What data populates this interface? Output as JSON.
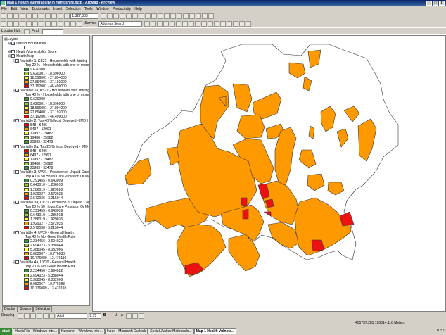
{
  "window": {
    "title": "Map 1 Health Vulnerability in Hampshire.mxd - ArcMap - ArcView",
    "minimize": "_",
    "maximize": "□",
    "close": "x"
  },
  "menu": [
    "File",
    "Edit",
    "View",
    "Bookmarks",
    "Insert",
    "Selection",
    "Tools",
    "Window",
    "Productivity",
    "Help"
  ],
  "toolbar": {
    "scale_value": "1:327,803",
    "service_label": "Service",
    "address_label": "Address Search",
    "locator_label": "Locator Hub",
    "find_label": "Find:"
  },
  "toc": {
    "root": "Layers",
    "layers": [
      {
        "label": "District Boundaries",
        "checked": true
      },
      {
        "label": "Health Vulnerability Score",
        "checked": false
      },
      {
        "label": "Health Map",
        "checked": true
      }
    ],
    "variables": [
      {
        "title": "Variable 1, KS21 - Households with limiting lon",
        "checked": true,
        "subtitle": "Top 20 % - Households with one or more",
        "classes": [
          "9.620000",
          "9.620001 - 18.596000",
          "18.596001 - 27.894000",
          "27.894001 - 37.192000",
          "37.192001 - 46.490000"
        ],
        "colors": [
          "#339933",
          "#99cc33",
          "#ffff33",
          "#ff9900",
          "#ee0000"
        ]
      },
      {
        "title": "Variable 1a, KS21 - Households with limiting lo",
        "checked": true,
        "subtitle": "Top 40 % - Households with one or more",
        "classes": [
          "9.620000",
          "9.620001 - 18.596000",
          "18.596001 - 27.894000",
          "27.894001 - 37.192000",
          "37.192001 - 46.490000"
        ],
        "colors": [
          "#339933",
          "#99cc33",
          "#ffff33",
          "#ff9900",
          "#ee0000"
        ]
      },
      {
        "title": "Variable 2, Top 40 % Most Deprived - IMD He",
        "checked": false,
        "subtitle": "",
        "classes": [
          "848 - 6496",
          "6497 - 12991",
          "12992 - 19487",
          "19488 - 25982",
          "25983 - 32478"
        ],
        "colors": [
          "#ee0000",
          "#ff9900",
          "#ffff33",
          "#99cc33",
          "#339933"
        ]
      },
      {
        "title": "Variable 2a, Top 20 % Most Deprived - IMD H",
        "checked": false,
        "subtitle": "",
        "classes": [
          "848 - 6496",
          "6497 - 12991",
          "12992 - 19487",
          "19488 - 25982",
          "25983 - 32478"
        ],
        "colors": [
          "#ee0000",
          "#ff9900",
          "#ffff33",
          "#99cc33",
          "#339933"
        ]
      },
      {
        "title": "Variable 3, UV21 - Provision of Unpaid Care",
        "checked": false,
        "subtitle": "Top 40 % 50 Hours Care Provision Or Mor",
        "classes": [
          "0.291455 - 0.643009",
          "0.643010 - 1.286018",
          "1.286019 - 1.929026",
          "1.929027 - 2.572035",
          "2.572036 - 3.215044"
        ],
        "colors": [
          "#339933",
          "#99cc33",
          "#ffff33",
          "#ff9900",
          "#ee0000"
        ]
      },
      {
        "title": "Variable 3a, UV21 - Provision of Unpaid Care",
        "checked": false,
        "subtitle": "Top 20 % 50 Hours Care Provision Or Mor",
        "classes": [
          "0.291455 - 0.643009",
          "0.643010 - 1.286018",
          "1.286019 - 1.929026",
          "1.929027 - 2.572035",
          "2.572036 - 3.215044"
        ],
        "colors": [
          "#339933",
          "#99cc33",
          "#ffff33",
          "#ff9900",
          "#ee0000"
        ]
      },
      {
        "title": "Variable 4, UV20 - General Health",
        "checked": false,
        "subtitle": "Top 40 % Not Good Health Rate",
        "classes": [
          "2.234456 - 2.694022",
          "2.694023 - 5.388044",
          "5.388045 - 8.082066",
          "8.082067 - 10.776088",
          "10.776089 - 13.470110"
        ],
        "colors": [
          "#339933",
          "#99cc33",
          "#ffff33",
          "#ff9900",
          "#ee0000"
        ]
      },
      {
        "title": "Variable 4a, UV20 - General Health",
        "checked": false,
        "subtitle": "Top 20 % Not Good Health Rate",
        "classes": [
          "2.234456 - 2.694022",
          "2.694023 - 5.388044",
          "5.388045 - 8.082066",
          "8.082067 - 10.776088",
          "10.776089 - 13.470110"
        ],
        "colors": [
          "#339933",
          "#99cc33",
          "#ffff33",
          "#ff9900",
          "#ee0000"
        ]
      }
    ]
  },
  "tabs": [
    "Display",
    "Source",
    "Selection"
  ],
  "drawing": {
    "label": "Drawing",
    "font": "Arial",
    "size": "8.75",
    "bold": "B",
    "italic": "I",
    "underline": "U",
    "fontcolor": "A"
  },
  "status": {
    "coords": "455737.281  120614.110 Meters"
  },
  "taskbar": {
    "start": "start",
    "tasks": [
      "HantsFile - Windows Inte...",
      "Hantsnet - Windows Inte...",
      "Inbox - Microsoft Outlook",
      "Social Justice Methodolo...",
      "Map 1 Health Vulnera..."
    ],
    "active_index": 4,
    "clock": "11:57"
  },
  "map": {
    "fill_orange": "#ff9900",
    "fill_red": "#ee1111",
    "outline": "#333333"
  }
}
